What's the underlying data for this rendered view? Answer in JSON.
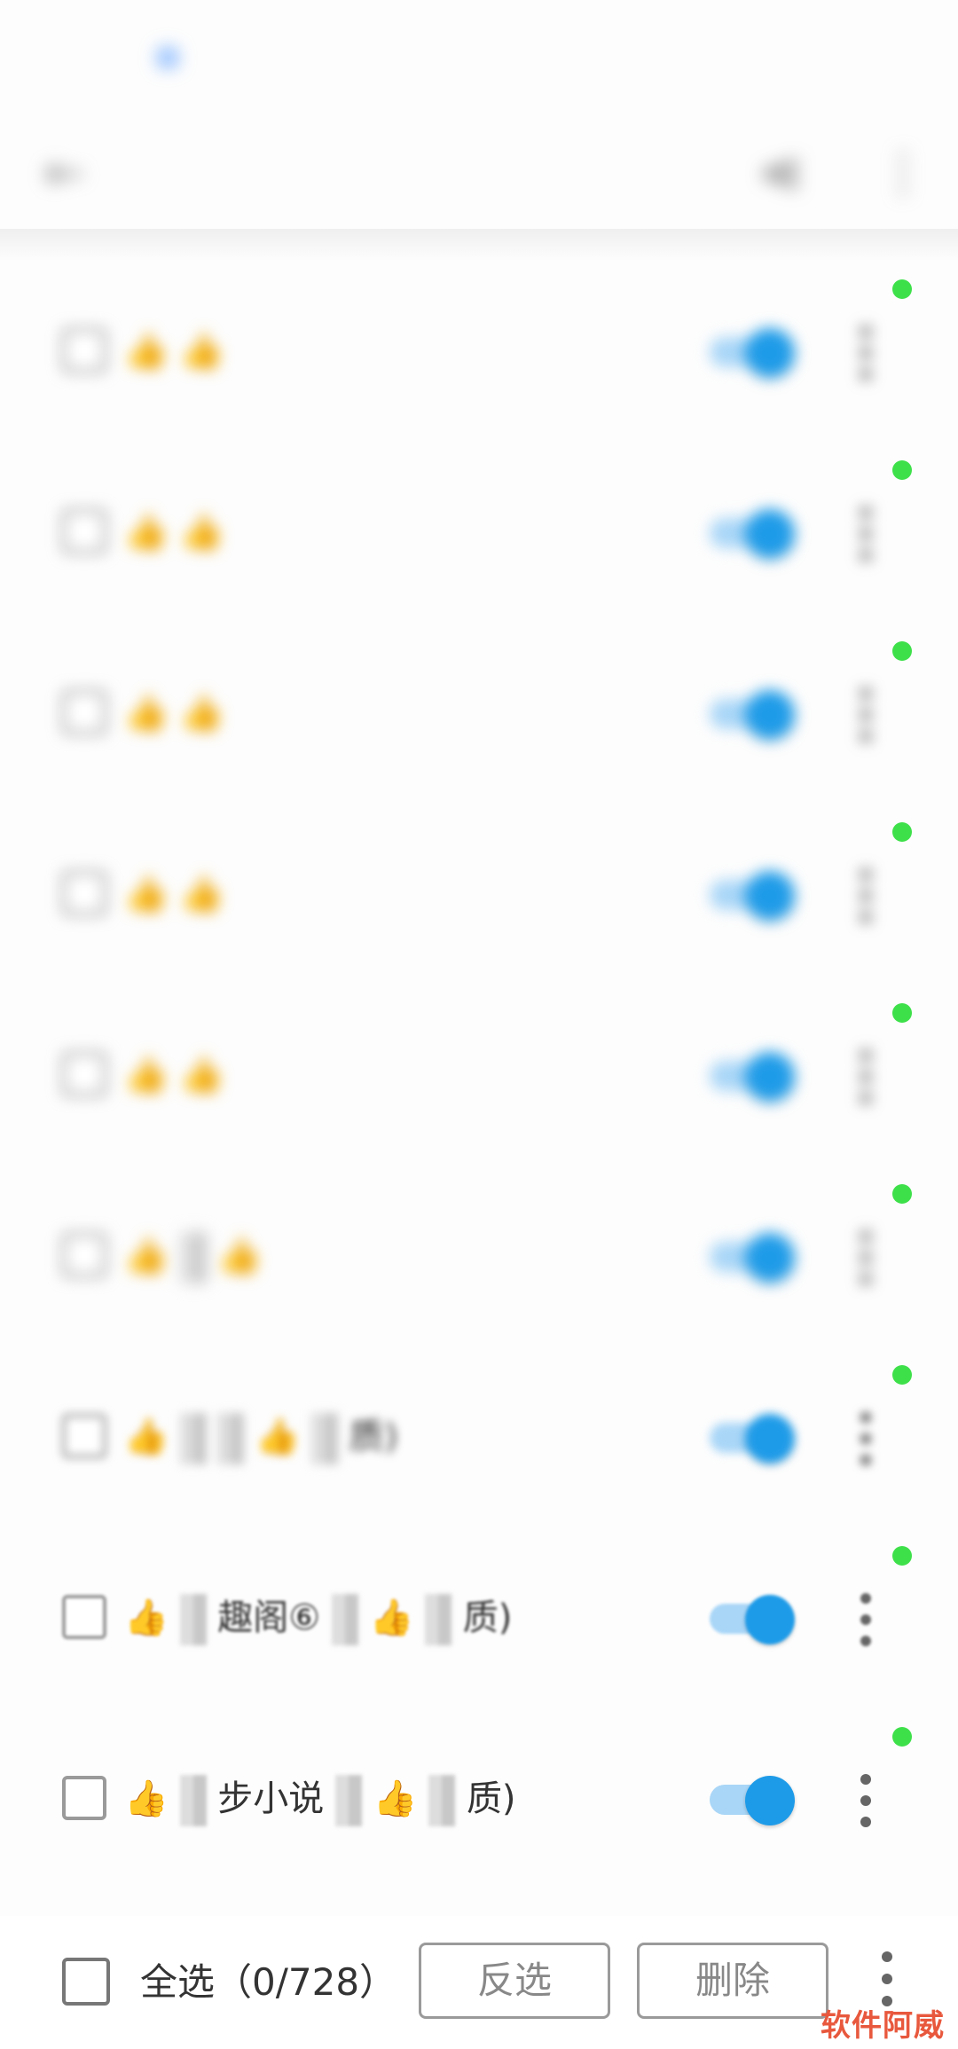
{
  "status_bar": {
    "left_text": "",
    "right_text": ""
  },
  "toolbar": {
    "title": ""
  },
  "rows": [
    {
      "label_a": "",
      "label_b": "",
      "enabled": true
    },
    {
      "label_a": "",
      "label_b": "",
      "enabled": true
    },
    {
      "label_a": "",
      "label_b": "",
      "enabled": true
    },
    {
      "label_a": "",
      "label_b": "",
      "enabled": true
    },
    {
      "label_a": "",
      "label_b": "",
      "enabled": true
    },
    {
      "label_a": "",
      "label_b": "",
      "enabled": true
    },
    {
      "label_a": "",
      "label_b": "质)",
      "enabled": true
    },
    {
      "label_a": "趣阁⑥",
      "label_b": "质)",
      "enabled": true
    },
    {
      "label_a": "步小说",
      "label_b": "质)",
      "enabled": true
    }
  ],
  "bottom_bar": {
    "select_all_label": "全选",
    "count": "（0/728）",
    "invert_label": "反选",
    "delete_label": "删除"
  },
  "watermark": "软件阿威",
  "colors": {
    "toggle_on": "#1e9be8",
    "toggle_track": "#a9d6f7",
    "status_dot": "#3ee04a",
    "watermark": "#e8583d"
  },
  "icons": {
    "back": "arrow-left-icon",
    "share": "share-icon",
    "more": "more-vertical-icon",
    "thumb": "thumbs-up-icon"
  }
}
